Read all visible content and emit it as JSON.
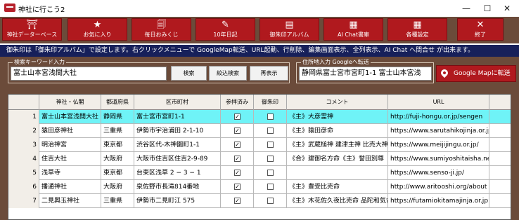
{
  "window": {
    "title": "神社に行こう2",
    "controls": {
      "minimize": "—",
      "maximize": "☐",
      "close": "✕"
    }
  },
  "toolbar": {
    "buttons": [
      {
        "label": "神社データーベース",
        "icon": "shrine-search-icon",
        "glyph": "⛩"
      },
      {
        "label": "お気に入り",
        "icon": "star-icon",
        "glyph": "★"
      },
      {
        "label": "毎日おみくじ",
        "icon": "omikuji-icon",
        "glyph": "🗐"
      },
      {
        "label": "10年日記",
        "icon": "diary-icon",
        "glyph": "✎"
      },
      {
        "label": "御朱印アルバム",
        "icon": "album-icon",
        "glyph": "▤"
      },
      {
        "label": "AI Chat書庫",
        "icon": "chat-archive-icon",
        "glyph": "▦"
      },
      {
        "label": "各種設定",
        "icon": "settings-grid-icon",
        "glyph": "▦"
      },
      {
        "label": "終了",
        "icon": "exit-icon",
        "glyph": "✕"
      }
    ]
  },
  "notice": "御朱印は「御朱印アルバム」で設定します。右クリックメニューで GoogleMap転送、URL起動、行削除、編集画面表示、全列表示、AI Chat へ問合せ が出来ます。",
  "search": {
    "group_label": "検索キーワード入力",
    "value": "富士山本宮浅間大社",
    "search_button": "検索",
    "refine_button": "絞込検索",
    "redisplay_button": "再表示"
  },
  "address": {
    "group_label": "住所地入力 Googleへ転送",
    "value": "静岡県富士宮市宮町1-1 富士山本宮浅",
    "map_button": "Google Mapに転送"
  },
  "grid": {
    "columns": [
      "",
      "神社・仏閣",
      "都道府県",
      "区市町村",
      "参拝済み",
      "御朱印",
      "コメント",
      "URL"
    ],
    "rows": [
      {
        "no": "1",
        "name": "富士山本宮浅間大社",
        "pref": "静岡県",
        "city": "富士宮市宮町1-1",
        "visited": true,
        "goshuin": false,
        "comment": "《主》大彦霊神",
        "url": "http://fuji-hongu.or.jp/sengen"
      },
      {
        "no": "2",
        "name": "猿田彦神社",
        "pref": "三重県",
        "city": "伊勢市宇治浦田 2-1-10",
        "visited": true,
        "goshuin": false,
        "comment": "《主》猿田彦命",
        "url": "https://www.sarutahikojinja.or.jp"
      },
      {
        "no": "3",
        "name": "明治神宮",
        "pref": "東京都",
        "city": "渋谷区代-木神園町1-1",
        "visited": true,
        "goshuin": false,
        "comment": "《主》武蔵槌神 建津主神 比売大神",
        "url": "https://www.meijijingu.or.jp/"
      },
      {
        "no": "4",
        "name": "住吉大社",
        "pref": "大阪府",
        "city": "大阪市住吉区住吉2-9-89",
        "visited": true,
        "goshuin": false,
        "comment": "《合》建御名方命《主》誉田別尊",
        "url": "https://www.sumiyoshitaisha.net"
      },
      {
        "no": "5",
        "name": "浅草寺",
        "pref": "東京都",
        "city": "台東区浅草 2 − 3 − 1",
        "visited": true,
        "goshuin": false,
        "comment": "",
        "url": "https://www.senso-ji.jp/"
      },
      {
        "no": "6",
        "name": "播通神社",
        "pref": "大阪府",
        "city": "泉佐野市長滝814番地",
        "visited": true,
        "goshuin": false,
        "comment": "《主》豊受比売命",
        "url": "http://www.aritooshi.org/about"
      },
      {
        "no": "7",
        "name": "二見興玉神社",
        "pref": "三重県",
        "city": "伊勢市二見町江 575",
        "visited": true,
        "goshuin": false,
        "comment": "《主》木花佐久夜比売命 品陀和気命",
        "url": "https://futamiokitamajinja.or.jp"
      }
    ]
  },
  "colors": {
    "brown": "#6b4b3a",
    "red": "#b0191e",
    "navy": "#17205a",
    "selected_row": "#6ff3f7"
  }
}
